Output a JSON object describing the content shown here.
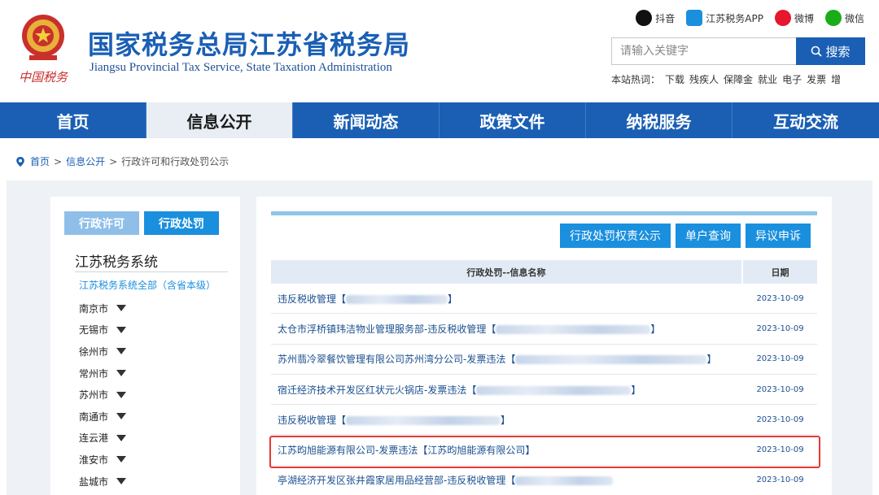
{
  "header": {
    "title": "国家税务总局江苏省税务局",
    "subtitle": "Jiangsu Provincial Tax Service, State Taxation Administration",
    "emblem_text": "中国税务",
    "social": [
      {
        "label": "抖音",
        "icon": "tiktok-icon",
        "color": "#111111"
      },
      {
        "label": "江苏税务APP",
        "icon": "app-icon",
        "color": "#1a8fde"
      },
      {
        "label": "微博",
        "icon": "weibo-icon",
        "color": "#e6162d"
      },
      {
        "label": "微信",
        "icon": "wechat-icon",
        "color": "#1aad19"
      }
    ],
    "search": {
      "placeholder": "请输入关键字",
      "button": "搜索"
    },
    "hot_words": {
      "label": "本站热词：",
      "items": [
        "下载",
        "残疾人",
        "保障金",
        "就业",
        "电子",
        "发票",
        "增"
      ]
    }
  },
  "nav": {
    "items": [
      {
        "label": "首页",
        "active": false
      },
      {
        "label": "信息公开",
        "active": true
      },
      {
        "label": "新闻动态",
        "active": false
      },
      {
        "label": "政策文件",
        "active": false
      },
      {
        "label": "纳税服务",
        "active": false
      },
      {
        "label": "互动交流",
        "active": false
      }
    ]
  },
  "breadcrumb": {
    "home": "首页",
    "sep": ">",
    "level1": "信息公开",
    "current": "行政许可和行政处罚公示"
  },
  "sidebar": {
    "tabs": [
      {
        "label": "行政许可",
        "active": false
      },
      {
        "label": "行政处罚",
        "active": true
      }
    ],
    "heading": "江苏税务系统",
    "all_link": "江苏税务系统全部（含省本级）",
    "cities": [
      "南京市",
      "无锡市",
      "徐州市",
      "常州市",
      "苏州市",
      "南通市",
      "连云港",
      "淮安市",
      "盐城市"
    ]
  },
  "content": {
    "actions": [
      "行政处罚权责公示",
      "单户查询",
      "异议申诉"
    ],
    "table": {
      "headers": {
        "name": "行政处罚--信息名称",
        "date": "日期"
      },
      "rows": [
        {
          "name": "违反税收管理【",
          "tail": "】",
          "date": "2023-10-09"
        },
        {
          "name": "太仓市浮桥镇玮洁物业管理服务部-违反税收管理【",
          "tail": "】",
          "date": "2023-10-09"
        },
        {
          "name": "苏州翡冷翠餐饮管理有限公司苏州湾分公司-发票违法【",
          "tail": "】",
          "date": "2023-10-09"
        },
        {
          "name": "宿迁经济技术开发区红状元火锅店-发票违法【",
          "tail": "】",
          "date": "2023-10-09"
        },
        {
          "name": "违反税收管理【",
          "tail": "】",
          "date": "2023-10-09"
        },
        {
          "name": "江苏昀旭能源有限公司-发票违法【江苏昀旭能源有限公司】",
          "tail": "",
          "date": "2023-10-09"
        },
        {
          "name": "亭湖经济开发区张井霞家居用品经营部-违反税收管理【",
          "tail": "",
          "date": "2023-10-09"
        }
      ]
    }
  },
  "colors": {
    "brand_blue": "#1a5fb4",
    "light_blue": "#1a8fde",
    "highlight_red": "#e53935"
  }
}
